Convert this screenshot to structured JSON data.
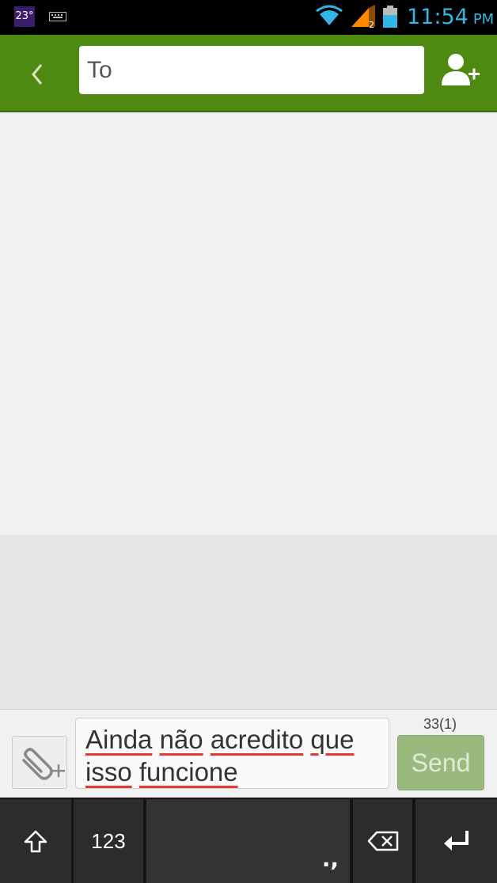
{
  "status_bar": {
    "weather_temp": "23°",
    "time": "11:54",
    "ampm": "PM",
    "signal_slot": "2"
  },
  "header": {
    "to_placeholder": "To"
  },
  "compose": {
    "message_words": [
      "Ainda",
      "não",
      "acredito",
      "que",
      "isso",
      "funcione"
    ],
    "counter": "33(1)",
    "send_label": "Send"
  },
  "keyboard": {
    "numbers_label": "123",
    "punct_label": ".,"
  },
  "icons": {
    "back": "chevron-left-icon",
    "add_contact": "person-add-icon",
    "attach": "paperclip-add-icon",
    "shift": "shift-arrow-icon",
    "delete": "backspace-icon",
    "enter": "enter-icon"
  },
  "colors": {
    "action_bar": "#4f8a10",
    "clock": "#33b5e5",
    "send_disabled": "#9ab97e",
    "spellcheck": "#e53935"
  }
}
